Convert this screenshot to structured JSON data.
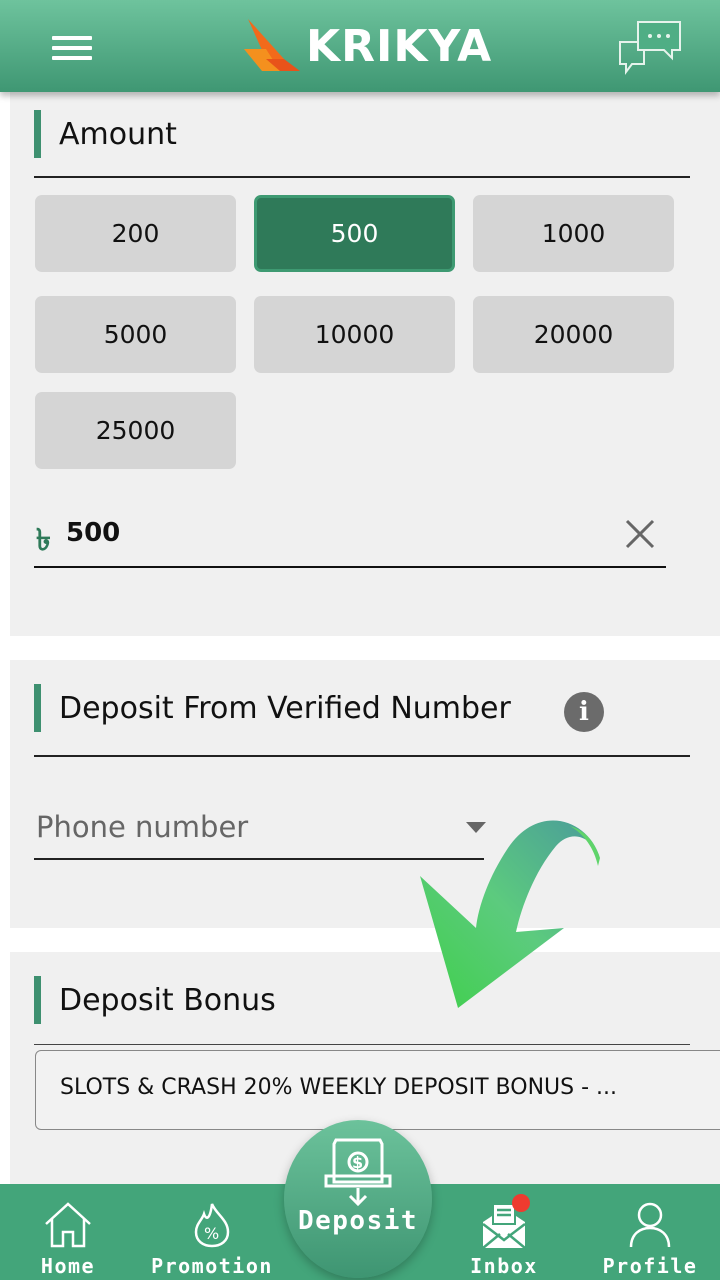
{
  "header": {
    "brand": "KRIKYA",
    "menu_icon": "hamburger-menu-icon",
    "chat_icon": "chat-bubbles-icon"
  },
  "amount_section": {
    "title": "Amount",
    "chips": [
      {
        "label": "200",
        "selected": false
      },
      {
        "label": "500",
        "selected": true
      },
      {
        "label": "1000",
        "selected": false
      },
      {
        "label": "5000",
        "selected": false
      },
      {
        "label": "10000",
        "selected": false
      },
      {
        "label": "20000",
        "selected": false
      },
      {
        "label": "25000",
        "selected": false
      }
    ],
    "currency_symbol": "৳",
    "input_value": "500",
    "clear_icon": "close-x-icon"
  },
  "verified_section": {
    "title": "Deposit From Verified Number",
    "info_icon": "i",
    "phone_placeholder": "Phone number"
  },
  "bonus_section": {
    "title": "Deposit Bonus",
    "selected_bonus": "SLOTS & CRASH 20% WEEKLY DEPOSIT BONUS - ..."
  },
  "bottom_nav": {
    "items": [
      {
        "label": "Home",
        "icon": "home-icon"
      },
      {
        "label": "Promotion",
        "icon": "promotion-fire-percent-icon"
      },
      {
        "label": "Deposit",
        "icon": "deposit-cash-icon"
      },
      {
        "label": "Inbox",
        "icon": "inbox-mail-icon",
        "has_badge": true
      },
      {
        "label": "Profile",
        "icon": "profile-user-icon"
      }
    ]
  },
  "colors": {
    "brand_green": "#43a57a",
    "selected_chip": "#2f7a59",
    "accent_bar": "#3e9070",
    "logo_orange": "#f26a1b",
    "badge_red": "#ee3b2f"
  }
}
